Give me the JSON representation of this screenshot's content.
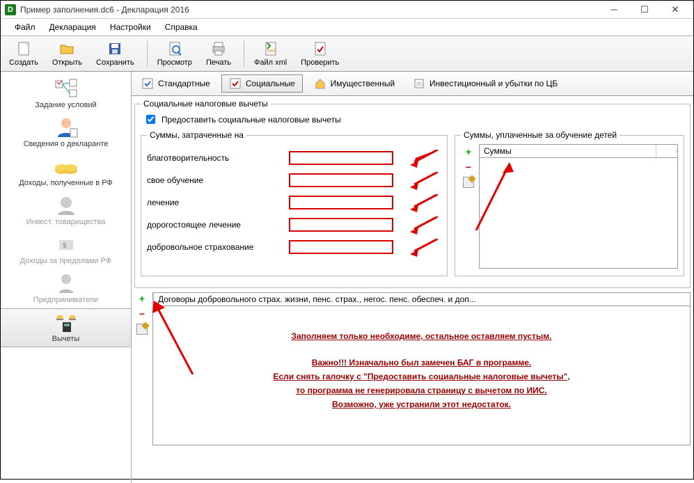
{
  "window": {
    "title": "Пример заполнения.dc6 - Декларация 2016",
    "app_icon_letter": "D"
  },
  "menu": {
    "file": "Файл",
    "declaration": "Декларация",
    "settings": "Настройки",
    "help": "Справка"
  },
  "toolbar": {
    "create": "Создать",
    "open": "Открыть",
    "save": "Сохранить",
    "preview": "Просмотр",
    "print": "Печать",
    "file_xml": "Файл xml",
    "check": "Проверить"
  },
  "sidebar": {
    "conditions": "Задание условий",
    "declarant": "Сведения о декларанте",
    "income_rf": "Доходы, полученные в РФ",
    "invest": "Инвест. товарищества",
    "income_abroad": "Доходы за пределами РФ",
    "entrepreneurs": "Предприниматели",
    "deductions": "Вычеты"
  },
  "tabs": {
    "standard": "Стандартные",
    "social": "Социальные",
    "property": "Имущественный",
    "investment": "Инвестиционный и убытки по ЦБ"
  },
  "social_group": {
    "legend": "Социальные налоговые вычеты",
    "checkbox": "Предоставить социальные налоговые вычеты"
  },
  "spent_group": {
    "legend": "Суммы, затраченные на",
    "charity": "благотворительность",
    "own_education": "свое обучение",
    "treatment": "лечение",
    "expensive_treatment": "дорогостоящее лечение",
    "insurance": "добровольное страхование"
  },
  "children_group": {
    "legend": "Суммы, уплаченные за обучение детей",
    "column": "Суммы"
  },
  "contracts": {
    "header": "Договоры добровольного страх. жизни, пенс. страх., негос. пенс. обеспеч. и доп..."
  },
  "annotations": {
    "line1": "Заполняем только необходиме, остальное оставляем пустым.",
    "line2": "Важно!!! Изначально был замечен БАГ в программе.",
    "line3": "Если снять галочку с \"Предоставить социальные налоговые вычеты\",",
    "line4": "то программа не генерировала страницу с вычетом по ИИС.",
    "line5": "Возможно, уже устранили этот недостаток."
  }
}
